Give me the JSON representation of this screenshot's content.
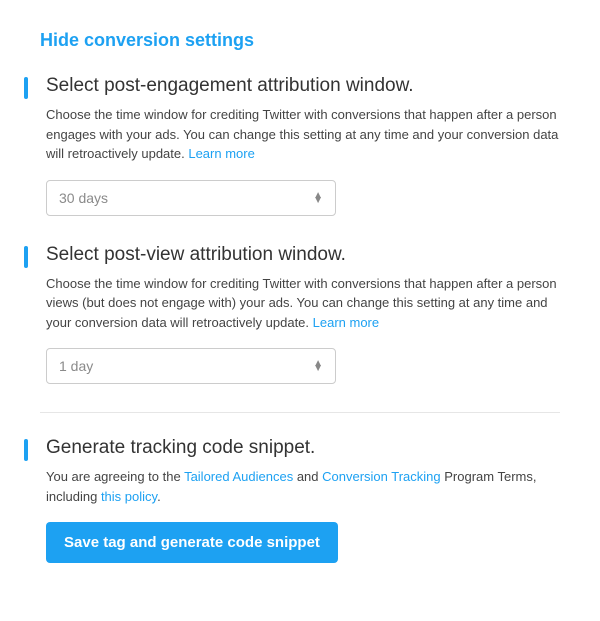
{
  "toggle_label": "Hide conversion settings",
  "sections": {
    "post_engagement": {
      "title": "Select post-engagement attribution window.",
      "desc_pre": "Choose the time window for crediting Twitter with conversions that happen after a person engages with your ads. You can change this setting at any time and your conversion data will retroactively update. ",
      "learn_more": "Learn more",
      "select_value": "30 days"
    },
    "post_view": {
      "title": "Select post-view attribution window.",
      "desc_pre": "Choose the time window for crediting Twitter with conversions that happen after a person views (but does not engage with) your ads. You can change this setting at any time and your conversion data will retroactively update. ",
      "learn_more": "Learn more",
      "select_value": "1 day"
    },
    "generate": {
      "title": "Generate tracking code snippet.",
      "text_1": "You are agreeing to the ",
      "link_1": "Tailored Audiences",
      "text_2": " and ",
      "link_2": "Conversion Tracking",
      "text_3": " Program Terms, including ",
      "link_3": "this policy",
      "text_4": ".",
      "button": "Save tag and generate code snippet"
    }
  }
}
